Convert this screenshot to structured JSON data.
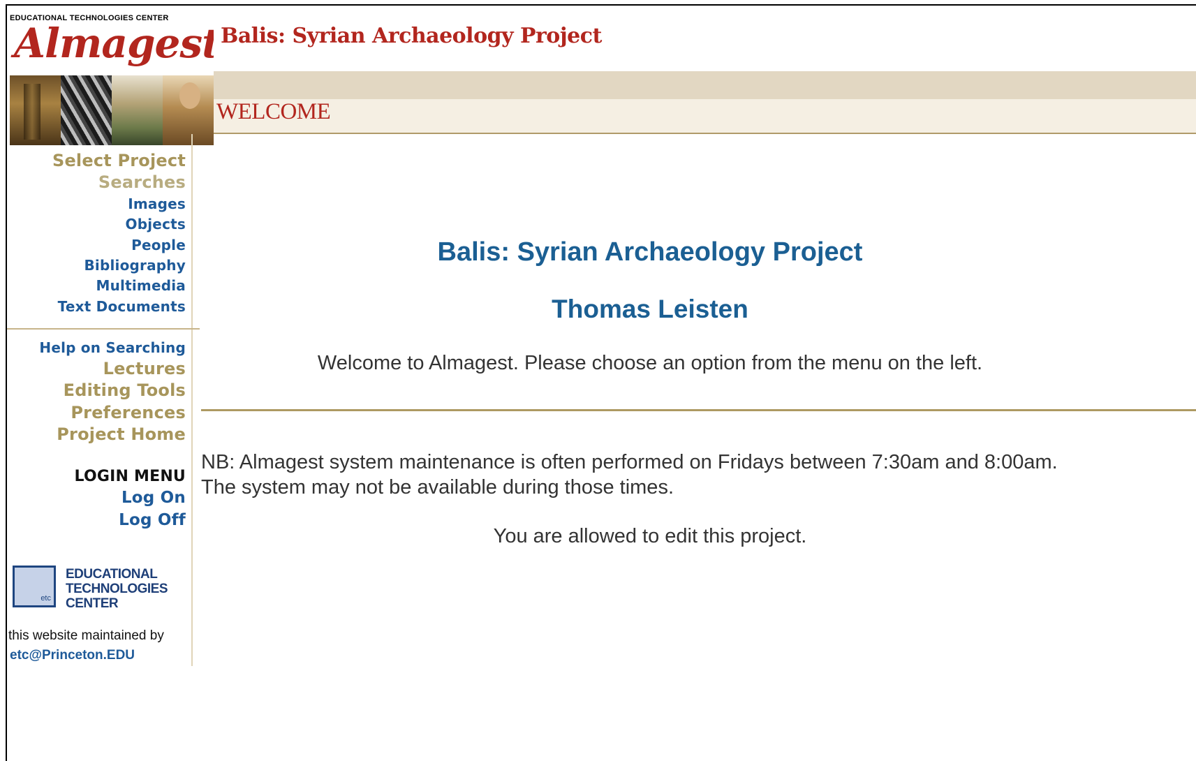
{
  "logo": {
    "caption": "EDUCATIONAL TECHNOLOGIES CENTER",
    "wordmark": "Almagest"
  },
  "header": {
    "site_title": "Balis: Syrian Archaeology Project",
    "section_title": "WELCOME"
  },
  "sidebar": {
    "select_project": "Select Project",
    "searches": "Searches",
    "search_links": [
      "Images",
      "Objects",
      "People",
      "Bibliography",
      "Multimedia",
      "Text Documents"
    ],
    "help_link": "Help on Searching",
    "tools_links": [
      "Lectures",
      "Editing Tools",
      "Preferences",
      "Project Home"
    ],
    "login_menu_heading": "LOGIN MENU",
    "login_links": [
      "Log On",
      "Log Off"
    ],
    "etc_logo_text": "etc",
    "etc_name": "EDUCATIONAL TECHNOLOGIES CENTER",
    "maintained_by": "this website maintained by",
    "maintainer_email": "etc@Princeton.EDU"
  },
  "main": {
    "project_title": "Balis: Syrian Archaeology Project",
    "author": "Thomas Leisten",
    "welcome_message": "Welcome to Almagest. Please choose an option from the menu on the left.",
    "nb_notice": "NB: Almagest system maintenance is often performed on Fridays between 7:30am and 8:00am. The system may not be available during those times.",
    "edit_permission": "You are allowed to edit this project."
  },
  "colors": {
    "accent_red": "#b2261e",
    "link_blue": "#1e5a99",
    "tan": "#a7955b",
    "band": "#e2d7c2"
  }
}
